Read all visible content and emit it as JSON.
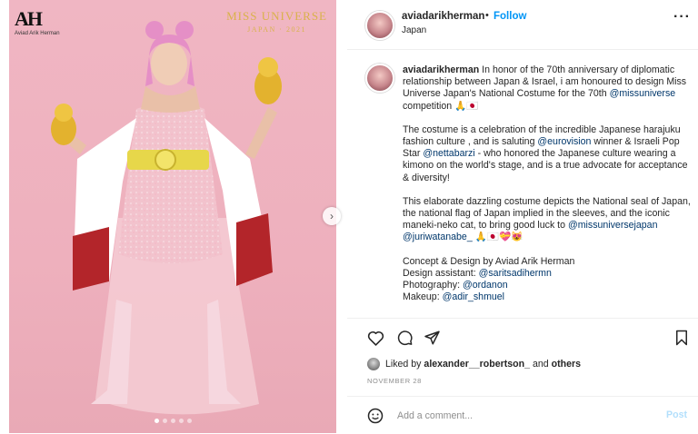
{
  "media": {
    "brand_mark": "AH",
    "brand_sub": "Aviad Arik Herman",
    "mu_line1": "MISS UNIVERSE",
    "mu_line2": "JAPAN · 2021",
    "slide_count": 5,
    "active_slide": 0,
    "next_glyph": "›"
  },
  "header": {
    "username": "aviadarikherman",
    "separator": "•",
    "follow_label": "Follow",
    "location": "Japan",
    "more_label": "···"
  },
  "caption": {
    "username": "aviadarikherman",
    "p1_text": " In honor of the 70th anniversary of diplomatic relationship between Japan & Israel, i am honoured to design Miss Universe Japan's National Costume for the 70th ",
    "p1_mention": "@missuniverse",
    "p1_tail": " competition 🙏🇯🇵",
    "p2_a": "The costume is a celebration of the incredible Japanese harajuku fashion culture , and is saluting ",
    "p2_mention1": "@eurovision",
    "p2_b": " winner & Israeli Pop Star ",
    "p2_mention2": "@nettabarzi",
    "p2_c": " - who honored the Japanese culture wearing a kimono on the world's stage, and is a true advocate for acceptance & diversity!",
    "p3_a": "This elaborate dazzling costume depicts the National seal of Japan, the national flag of Japan implied in the sleeves, and the iconic maneki-neko cat, to bring good luck to ",
    "p3_mention1": "@missuniversejapan",
    "p3_sp": " ",
    "p3_mention2": "@juriwatanabe_",
    "p3_tail": " 🙏🇯🇵💝😻",
    "credit_concept": "Concept & Design by Aviad Arik Herman",
    "credit_assistant_label": "Design assistant: ",
    "credit_assistant": "@saritsadihermn",
    "credit_photo_label": "Photography: ",
    "credit_photo": "@ordanon",
    "credit_makeup_label": "Makeup: ",
    "credit_makeup": "@adir_shmuel"
  },
  "likes": {
    "prefix": "Liked by ",
    "user": "alexander__robertson_",
    "middle": " and ",
    "others": "others"
  },
  "date": "NOVEMBER 28",
  "comment": {
    "placeholder": "Add a comment...",
    "post_label": "Post"
  },
  "colors": {
    "accent": "#0095f6",
    "mention": "#00376b",
    "muted": "#8e8e8e",
    "post_disabled": "#b2dffc",
    "media_bg": "#eeb0bd"
  }
}
